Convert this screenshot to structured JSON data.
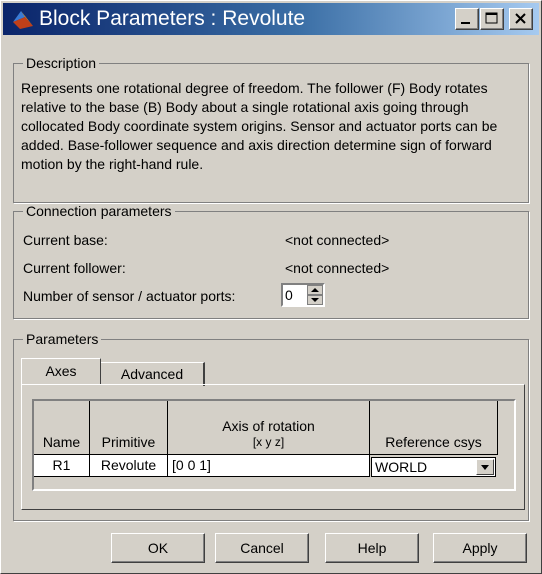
{
  "window": {
    "title": "Block Parameters : Revolute",
    "controls": {
      "minimize": "minimize-icon",
      "maximize": "maximize-icon",
      "close": "close-icon"
    }
  },
  "description": {
    "legend": "Description",
    "text": "Represents one rotational degree of freedom. The follower (F) Body rotates relative to the base (B) Body about a single rotational axis going through collocated Body coordinate system origins. Sensor and actuator ports can be added. Base-follower sequence and axis direction determine sign of forward motion by the right-hand rule."
  },
  "connection": {
    "legend": "Connection parameters",
    "current_base_label": "Current base:",
    "current_base_value": "<not connected>",
    "current_follower_label": "Current follower:",
    "current_follower_value": "<not connected>",
    "ports_label": "Number of sensor / actuator ports:",
    "ports_value": "0"
  },
  "parameters": {
    "legend": "Parameters",
    "tabs": [
      {
        "label": "Axes",
        "active": true
      },
      {
        "label": "Advanced",
        "active": false
      }
    ],
    "table": {
      "headers": {
        "name": "Name",
        "primitive": "Primitive",
        "axis_line1": "Axis of rotation",
        "axis_line2": "[x y z]",
        "reference": "Reference csys"
      },
      "row": {
        "name": "R1",
        "primitive": "Revolute",
        "axis": "[0 0 1]",
        "reference": "WORLD"
      }
    }
  },
  "buttons": {
    "ok": "OK",
    "cancel": "Cancel",
    "help": "Help",
    "apply": "Apply"
  },
  "colors": {
    "dialog_bg": "#d4d0c8",
    "titlebar_start": "#0a246a",
    "titlebar_end": "#a6caf0"
  }
}
